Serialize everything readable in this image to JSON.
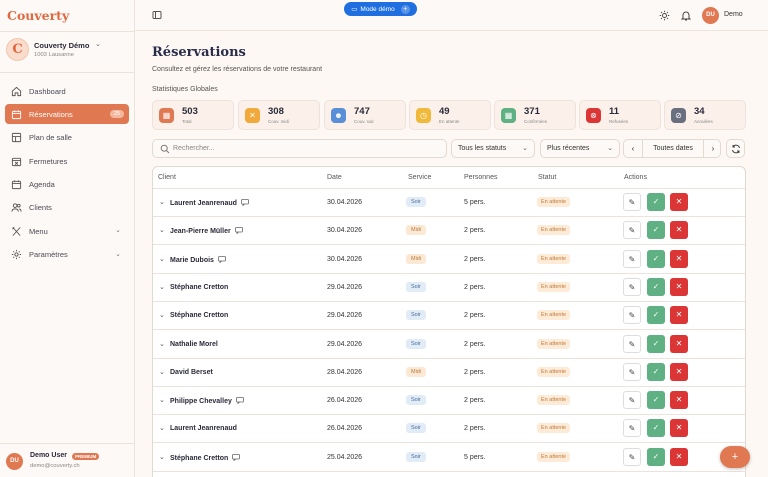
{
  "app": {
    "logo": "Couverty"
  },
  "restaurant": {
    "initial": "C",
    "name": "Couverty Démo",
    "city": "1003 Lausanne"
  },
  "sidebar": {
    "items": [
      {
        "label": "Dashboard",
        "icon": "home-icon"
      },
      {
        "label": "Réservations",
        "icon": "calendar-icon",
        "badge": "25",
        "active": true
      },
      {
        "label": "Plan de salle",
        "icon": "layout-icon"
      },
      {
        "label": "Fermetures",
        "icon": "calendar-off-icon"
      },
      {
        "label": "Agenda",
        "icon": "calendar-icon"
      },
      {
        "label": "Clients",
        "icon": "users-icon"
      },
      {
        "label": "Menu",
        "icon": "utensils-icon",
        "expandable": true
      },
      {
        "label": "Paramètres",
        "icon": "gear-icon",
        "expandable": true
      }
    ]
  },
  "user": {
    "initials": "DU",
    "name": "Demo User",
    "badge": "PREMIUM",
    "email": "demo@couverty.ch"
  },
  "topbar": {
    "demo_label": "Mode démo",
    "user_initials": "DU",
    "user_name": "Demo"
  },
  "page": {
    "title": "Réservations",
    "subtitle": "Consultez et gérez les réservations de votre restaurant",
    "stats_label": "Statistiques Globales"
  },
  "stats": [
    {
      "value": "503",
      "label": "Total",
      "color": "#e07852",
      "icon": "calendar-icon"
    },
    {
      "value": "308",
      "label": "Couv. midi",
      "color": "#f0a93a",
      "icon": "utensils-icon"
    },
    {
      "value": "747",
      "label": "Couv. soir",
      "color": "#5a8fd8",
      "icon": "users-icon"
    },
    {
      "value": "49",
      "label": "En attente",
      "color": "#f0b93a",
      "icon": "clock-icon"
    },
    {
      "value": "371",
      "label": "Confirmées",
      "color": "#5fb082",
      "icon": "check-calendar-icon"
    },
    {
      "value": "11",
      "label": "Refusées",
      "color": "#dc3535",
      "icon": "x-circle-icon"
    },
    {
      "value": "34",
      "label": "Annulées",
      "color": "#6a6f80",
      "icon": "ban-icon"
    }
  ],
  "filters": {
    "search_placeholder": "Rechercher...",
    "status": "Tous les statuts",
    "sort": "Plus récentes",
    "date_range": "Toutes dates"
  },
  "table": {
    "headers": [
      "Client",
      "Date",
      "Service",
      "Personnes",
      "Statut",
      "Actions"
    ],
    "rows": [
      {
        "client": "Laurent Jeanrenaud",
        "comment": true,
        "date": "30.04.2026",
        "service": "Soir",
        "persons": "5 pers.",
        "status": "En attente"
      },
      {
        "client": "Jean-Pierre Müller",
        "comment": true,
        "date": "30.04.2026",
        "service": "Midi",
        "persons": "2 pers.",
        "status": "En attente"
      },
      {
        "client": "Marie Dubois",
        "comment": true,
        "date": "30.04.2026",
        "service": "Midi",
        "persons": "2 pers.",
        "status": "En attente"
      },
      {
        "client": "Stéphane Cretton",
        "comment": false,
        "date": "29.04.2026",
        "service": "Soir",
        "persons": "2 pers.",
        "status": "En attente"
      },
      {
        "client": "Stéphane Cretton",
        "comment": false,
        "date": "29.04.2026",
        "service": "Soir",
        "persons": "2 pers.",
        "status": "En attente"
      },
      {
        "client": "Nathalie Morel",
        "comment": false,
        "date": "29.04.2026",
        "service": "Soir",
        "persons": "2 pers.",
        "status": "En attente"
      },
      {
        "client": "David Berset",
        "comment": false,
        "date": "28.04.2026",
        "service": "Midi",
        "persons": "2 pers.",
        "status": "En attente"
      },
      {
        "client": "Philippe Chevalley",
        "comment": true,
        "date": "26.04.2026",
        "service": "Soir",
        "persons": "2 pers.",
        "status": "En attente"
      },
      {
        "client": "Laurent Jeanrenaud",
        "comment": false,
        "date": "26.04.2026",
        "service": "Soir",
        "persons": "2 pers.",
        "status": "En attente"
      },
      {
        "client": "Stéphane Cretton",
        "comment": true,
        "date": "25.04.2026",
        "service": "Soir",
        "persons": "5 pers.",
        "status": "En attente"
      }
    ]
  },
  "fab_label": "+"
}
